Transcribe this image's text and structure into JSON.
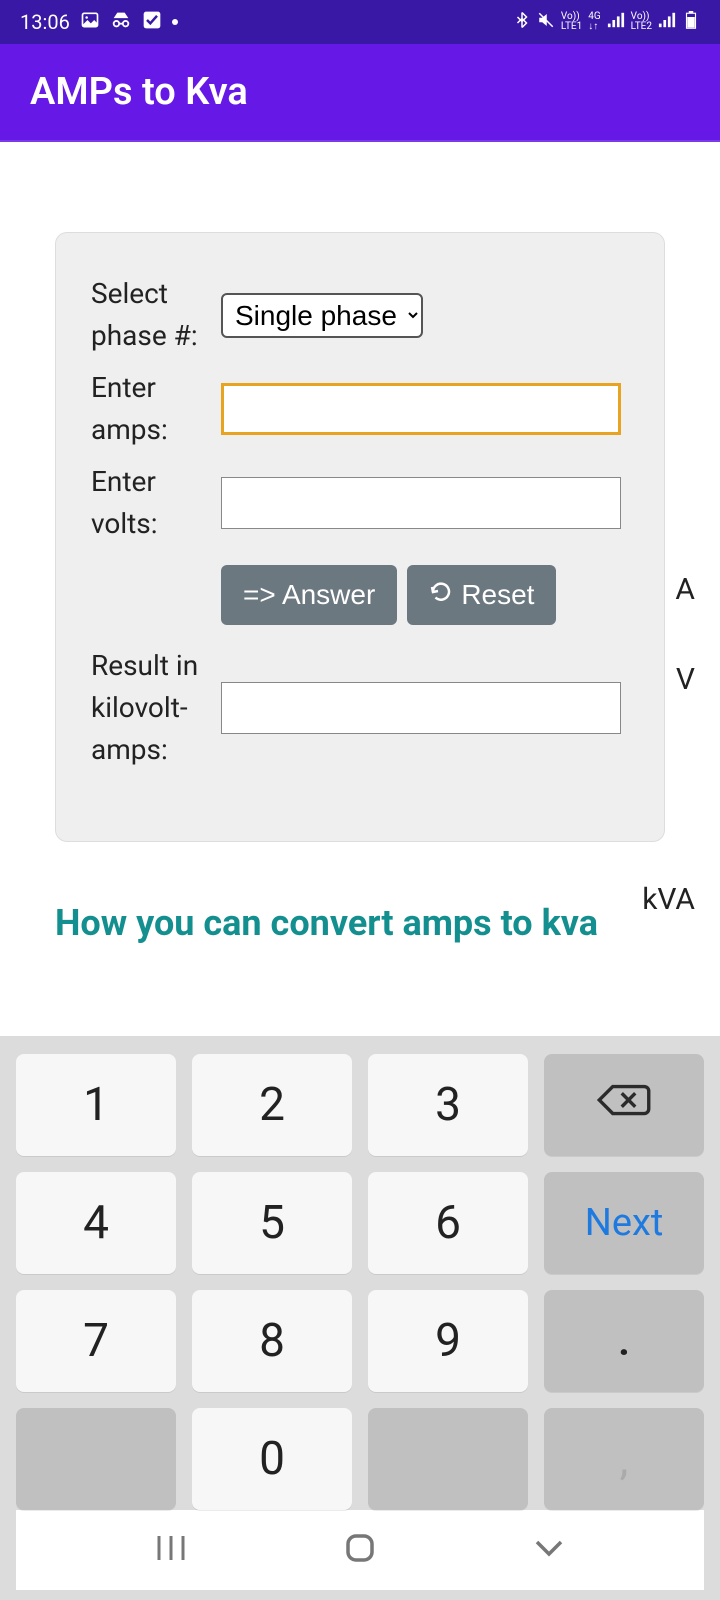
{
  "status": {
    "time": "13:06",
    "lte1": "LTE1",
    "lte2": "LTE2",
    "net": "4G",
    "vo": "Vo))"
  },
  "appbar": {
    "title": "AMPs to Kva"
  },
  "form": {
    "phase": {
      "label": "Select phase #:",
      "selected": "Single phase"
    },
    "amps": {
      "label": "Enter amps:",
      "value": "",
      "unit": "A"
    },
    "volts": {
      "label": "Enter volts:",
      "value": "",
      "unit": "V"
    },
    "answer_btn": "=> Answer",
    "reset_btn": "Reset",
    "result": {
      "label": "Result in kilovolt-amps:",
      "value": "",
      "unit": "kVA"
    }
  },
  "heading": "How you can convert amps to kva",
  "keys": {
    "k1": "1",
    "k2": "2",
    "k3": "3",
    "k4": "4",
    "k5": "5",
    "k6": "6",
    "k7": "7",
    "k8": "8",
    "k9": "9",
    "k0": "0",
    "dot": ".",
    "comma": ",",
    "next": "Next"
  }
}
